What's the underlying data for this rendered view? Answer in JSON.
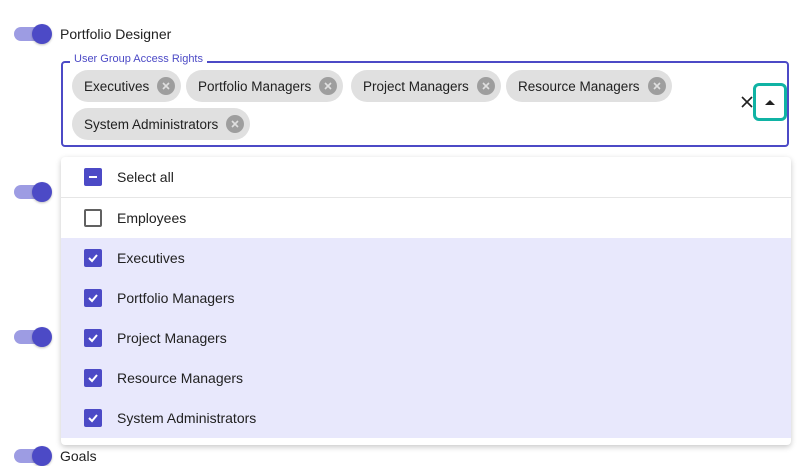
{
  "rows": {
    "portfolio_designer_label": "Portfolio Designer",
    "goals_label": "Goals"
  },
  "select": {
    "label": "User Group Access Rights",
    "chips": [
      "Executives",
      "Portfolio Managers",
      "Project Managers",
      "Resource Managers",
      "System Administrators"
    ],
    "clear_icon": "close-icon",
    "popup_icon": "arrow-up-icon"
  },
  "options": {
    "select_all": "Select all",
    "items": [
      {
        "label": "Employees",
        "checked": false
      },
      {
        "label": "Executives",
        "checked": true
      },
      {
        "label": "Portfolio Managers",
        "checked": true
      },
      {
        "label": "Project Managers",
        "checked": true
      },
      {
        "label": "Resource Managers",
        "checked": true
      },
      {
        "label": "System Administrators",
        "checked": true
      }
    ]
  },
  "colors": {
    "accent": "#4c4ac6",
    "focus_ring": "#10b3a4",
    "selected_bg": "#e8e8fc"
  }
}
